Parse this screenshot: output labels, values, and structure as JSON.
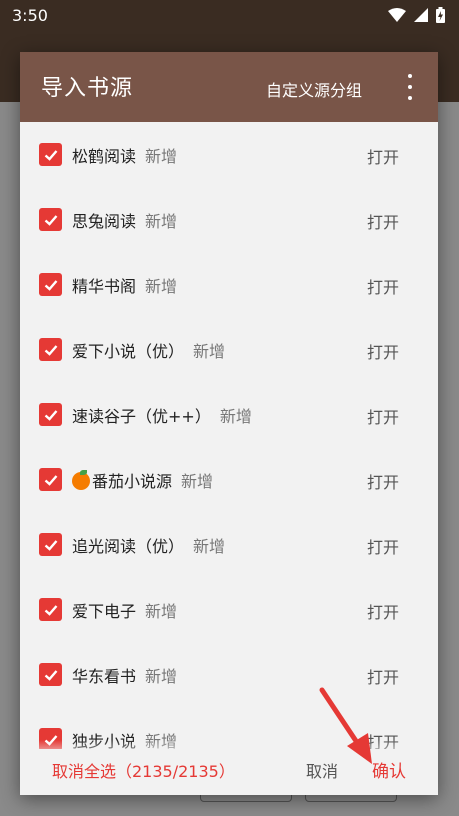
{
  "status_bar": {
    "time": "3:50"
  },
  "dialog": {
    "title": "导入书源",
    "group_button": "自定义源分组",
    "items": [
      {
        "name": "松鹤阅读",
        "tag": "新增",
        "action": "打开"
      },
      {
        "name": "思兔阅读",
        "tag": "新增",
        "action": "打开"
      },
      {
        "name": "精华书阁",
        "tag": "新增",
        "action": "打开"
      },
      {
        "name": "爱下小说（优）",
        "tag": "新增",
        "action": "打开"
      },
      {
        "name": "速读谷子（优++）",
        "tag": "新增",
        "action": "打开"
      },
      {
        "name": "番茄小说源",
        "tag": "新增",
        "action": "打开"
      },
      {
        "name": "追光阅读（优）",
        "tag": "新增",
        "action": "打开"
      },
      {
        "name": "爱下电子",
        "tag": "新增",
        "action": "打开"
      },
      {
        "name": "华东看书",
        "tag": "新增",
        "action": "打开"
      },
      {
        "name": "独步小说",
        "tag": "新增",
        "action": "打开"
      }
    ],
    "footer": {
      "deselect_all": "取消全选（2135/2135）",
      "cancel": "取消",
      "confirm": "确认"
    }
  },
  "colors": {
    "header": "#795548",
    "accent": "#e53935",
    "arrow": "#e53935"
  }
}
